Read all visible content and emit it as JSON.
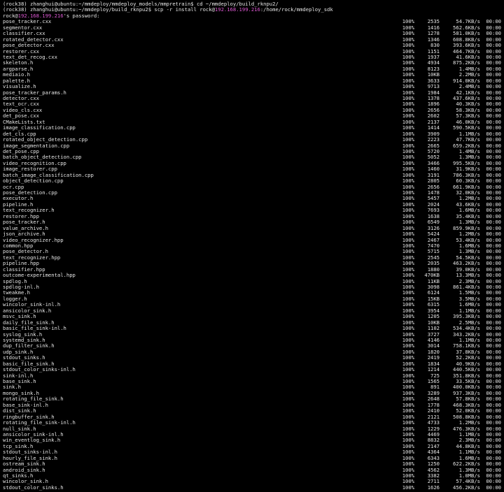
{
  "header_lines": [
    "(rock38) zhanghui@ubuntu:~/mmdeploy/mmdeploy_models/mmpretrain$ cd ~/mmdeploy/build_rknpu2/",
    {
      "pre": "(rock38) zhanghui@ubuntu:~/mmdeploy/build_rknpu2$ scp -r install rock@",
      "ip": "192.168.199.216",
      "post": ":/home/rock/mmdeploy_sdk"
    },
    {
      "pre": "rock@",
      "ip": "192.168.199.216",
      "post": "'s password:"
    }
  ],
  "colors": {
    "background": "#000000",
    "text": "#e6e6e6",
    "ip": "#e05ad6"
  },
  "files": [
    [
      "pose_tracker.cxx",
      "100%",
      "2535",
      "54.7KB/s",
      "00:00"
    ],
    [
      "segmentor.cxx",
      "100%",
      "1416",
      "562.6KB/s",
      "00:00"
    ],
    [
      "classifier.cxx",
      "100%",
      "1278",
      "581.0KB/s",
      "00:00"
    ],
    [
      "rotated_detector.cxx",
      "100%",
      "1346",
      "608.8KB/s",
      "00:00"
    ],
    [
      "pose_detector.cxx",
      "100%",
      "830",
      "393.6KB/s",
      "00:00"
    ],
    [
      "restorer.cxx",
      "100%",
      "1151",
      "464.7KB/s",
      "00:00"
    ],
    [
      "text_det_recog.cxx",
      "100%",
      "1937",
      "41.6KB/s",
      "00:00"
    ],
    [
      "skeleton.h",
      "100%",
      "4934",
      "875.2KB/s",
      "00:00"
    ],
    [
      "argparse.h",
      "100%",
      "8123",
      "1.4MB/s",
      "00:00"
    ],
    [
      "mediaio.h",
      "100%",
      "10KB",
      "2.2MB/s",
      "00:00"
    ],
    [
      "palette.h",
      "100%",
      "3633",
      "914.0KB/s",
      "00:00"
    ],
    [
      "visualize.h",
      "100%",
      "9713",
      "2.4MB/s",
      "00:00"
    ],
    [
      "pose_tracker_params.h",
      "100%",
      "1984",
      "42.1KB/s",
      "00:00"
    ],
    [
      "detector.cxx",
      "100%",
      "1378",
      "437.6KB/s",
      "00:00"
    ],
    [
      "text_ocr.cxx",
      "100%",
      "1896",
      "40.3KB/s",
      "00:00"
    ],
    [
      "video_cls.cxx",
      "100%",
      "2656",
      "58.3KB/s",
      "00:00"
    ],
    [
      "det_pose.cxx",
      "100%",
      "2602",
      "57.3KB/s",
      "00:00"
    ],
    [
      "CMakeLists.txt",
      "100%",
      "2137",
      "46.0KB/s",
      "00:00"
    ],
    [
      "image_classification.cpp",
      "100%",
      "1414",
      "590.5KB/s",
      "00:00"
    ],
    [
      "det_cls.cpp",
      "100%",
      "3909",
      "1.1MB/s",
      "00:00"
    ],
    [
      "rotated_object_detection.cpp",
      "100%",
      "2223",
      "47.7KB/s",
      "00:00"
    ],
    [
      "image_segmentation.cpp",
      "100%",
      "2665",
      "659.2KB/s",
      "00:00"
    ],
    [
      "det_pose.cpp",
      "100%",
      "5720",
      "1.4MB/s",
      "00:00"
    ],
    [
      "batch_object_detection.cpp",
      "100%",
      "5052",
      "1.3MB/s",
      "00:00"
    ],
    [
      "video_recognition.cpp",
      "100%",
      "3466",
      "995.5KB/s",
      "00:00"
    ],
    [
      "image_restorer.cpp",
      "100%",
      "1460",
      "31.9KB/s",
      "00:00"
    ],
    [
      "batch_image_classification.cpp",
      "100%",
      "3191",
      "786.3KB/s",
      "00:00"
    ],
    [
      "object_detection.cpp",
      "100%",
      "2805",
      "60.3KB/s",
      "00:00"
    ],
    [
      "ocr.cpp",
      "100%",
      "2656",
      "661.9KB/s",
      "00:00"
    ],
    [
      "pose_detection.cpp",
      "100%",
      "1478",
      "32.0KB/s",
      "00:00"
    ],
    [
      "executor.h",
      "100%",
      "5457",
      "1.2MB/s",
      "00:00"
    ],
    [
      "pipeline.h",
      "100%",
      "2024",
      "43.6KB/s",
      "00:00"
    ],
    [
      "text_recognizer.h",
      "100%",
      "7693",
      "1.6MB/s",
      "00:00"
    ],
    [
      "restorer.hpp",
      "100%",
      "1638",
      "35.4KB/s",
      "00:00"
    ],
    [
      "pose_tracker.h",
      "100%",
      "6549",
      "1.3MB/s",
      "00:00"
    ],
    [
      "value_archive.h",
      "100%",
      "3126",
      "859.9KB/s",
      "00:00"
    ],
    [
      "json_archive.h",
      "100%",
      "5424",
      "1.2MB/s",
      "00:00"
    ],
    [
      "video_recognizer.hpp",
      "100%",
      "2467",
      "53.4KB/s",
      "00:00"
    ],
    [
      "common.hpp",
      "100%",
      "7470",
      "1.6MB/s",
      "00:00"
    ],
    [
      "pose_detector.h",
      "100%",
      "5715",
      "1.3MB/s",
      "00:00"
    ],
    [
      "text_recognizer.hpp",
      "100%",
      "2545",
      "54.5KB/s",
      "00:00"
    ],
    [
      "pipeline.hpp",
      "100%",
      "2035",
      "463.2KB/s",
      "00:00"
    ],
    [
      "classifier.hpp",
      "100%",
      "1880",
      "39.0KB/s",
      "00:00"
    ],
    [
      "outcome-experimental.hpp",
      "100%",
      "470KB",
      "13.3MB/s",
      "00:00"
    ],
    [
      "spdlog.h",
      "100%",
      "11KB",
      "2.3MB/s",
      "00:00"
    ],
    [
      "spdlog-inl.h",
      "100%",
      "3098",
      "861.4KB/s",
      "00:00"
    ],
    [
      "tweakme.h",
      "100%",
      "6124",
      "1.5MB/s",
      "00:00"
    ],
    [
      "logger.h",
      "100%",
      "15KB",
      "3.5MB/s",
      "00:00"
    ],
    [
      "wincolor_sink-inl.h",
      "100%",
      "6315",
      "1.6MB/s",
      "00:00"
    ],
    [
      "ansicolor_sink.h",
      "100%",
      "3954",
      "1.1MB/s",
      "00:00"
    ],
    [
      "msvc_sink.h",
      "100%",
      "1205",
      "395.3KB/s",
      "00:00"
    ],
    [
      "daily_file_sink.h",
      "100%",
      "10KB",
      "2.5MB/s",
      "00:00"
    ],
    [
      "basic_file_sink-inl.h",
      "100%",
      "1102",
      "534.4KB/s",
      "00:00"
    ],
    [
      "syslog_sink.h",
      "100%",
      "3727",
      "343.2KB/s",
      "00:00"
    ],
    [
      "systemd_sink.h",
      "100%",
      "4146",
      "1.1MB/s",
      "00:00"
    ],
    [
      "dup_filter_sink.h",
      "100%",
      "3014",
      "758.1KB/s",
      "00:00"
    ],
    [
      "udp_sink.h",
      "100%",
      "1820",
      "37.8KB/s",
      "00:00"
    ],
    [
      "stdout_sinks.h",
      "100%",
      "2419",
      "52.2KB/s",
      "00:00"
    ],
    [
      "basic_file_sink.h",
      "100%",
      "1834",
      "40.9KB/s",
      "00:00"
    ],
    [
      "stdout_color_sinks-inl.h",
      "100%",
      "1214",
      "440.5KB/s",
      "00:00"
    ],
    [
      "sink-inl.h",
      "100%",
      "725",
      "351.8KB/s",
      "00:00"
    ],
    [
      "base_sink.h",
      "100%",
      "1565",
      "33.5KB/s",
      "00:00"
    ],
    [
      "sink.h",
      "100%",
      "891",
      "400.0KB/s",
      "00:00"
    ],
    [
      "mongo_sink.h",
      "100%",
      "3289",
      "937.3KB/s",
      "00:00"
    ],
    [
      "rotating_file_sink.h",
      "100%",
      "2648",
      "57.8KB/s",
      "00:00"
    ],
    [
      "base_sink-inl.h",
      "100%",
      "1778",
      "468.3KB/s",
      "00:00"
    ],
    [
      "dist_sink.h",
      "100%",
      "2410",
      "52.0KB/s",
      "00:00"
    ],
    [
      "ringbuffer_sink.h",
      "100%",
      "2121",
      "508.8KB/s",
      "00:00"
    ],
    [
      "rotating_file_sink-inl.h",
      "100%",
      "4733",
      "1.2MB/s",
      "00:00"
    ],
    [
      "null_sink.h",
      "100%",
      "1229",
      "476.3KB/s",
      "00:00"
    ],
    [
      "ansicolor_sink-inl.h",
      "100%",
      "4469",
      "1.1MB/s",
      "00:00"
    ],
    [
      "win_eventlog_sink.h",
      "100%",
      "8832",
      "2.3MB/s",
      "00:00"
    ],
    [
      "tcp_sink.h",
      "100%",
      "2147",
      "44.8KB/s",
      "00:00"
    ],
    [
      "stdout_sinks-inl.h",
      "100%",
      "4364",
      "1.1MB/s",
      "00:00"
    ],
    [
      "hourly_file_sink.h",
      "100%",
      "6343",
      "1.6MB/s",
      "00:00"
    ],
    [
      "ostream_sink.h",
      "100%",
      "1250",
      "622.2KB/s",
      "00:00"
    ],
    [
      "android_sink.h",
      "100%",
      "4562",
      "1.3MB/s",
      "00:00"
    ],
    [
      "qt_sinks.h",
      "100%",
      "3382",
      "1.0MB/s",
      "00:00"
    ],
    [
      "wincolor_sink.h",
      "100%",
      "2711",
      "57.4KB/s",
      "00:00"
    ],
    [
      "stdout_color_sinks.h",
      "100%",
      "1626",
      "456.2KB/s",
      "00:00"
    ]
  ]
}
